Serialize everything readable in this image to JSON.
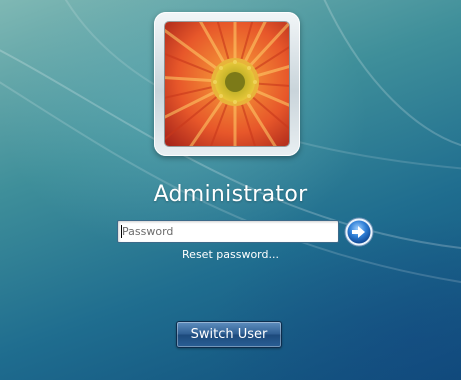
{
  "user": {
    "name": "Administrator",
    "avatar_icon": "flower-avatar-icon"
  },
  "password": {
    "placeholder": "Password",
    "value": ""
  },
  "actions": {
    "submit_icon": "arrow-right-icon",
    "reset_label": "Reset password...",
    "switch_user_label": "Switch User"
  },
  "colors": {
    "background_top": "#7fb8b4",
    "background_bottom": "#0f4b7a",
    "button_blue": "#2f5f93"
  }
}
